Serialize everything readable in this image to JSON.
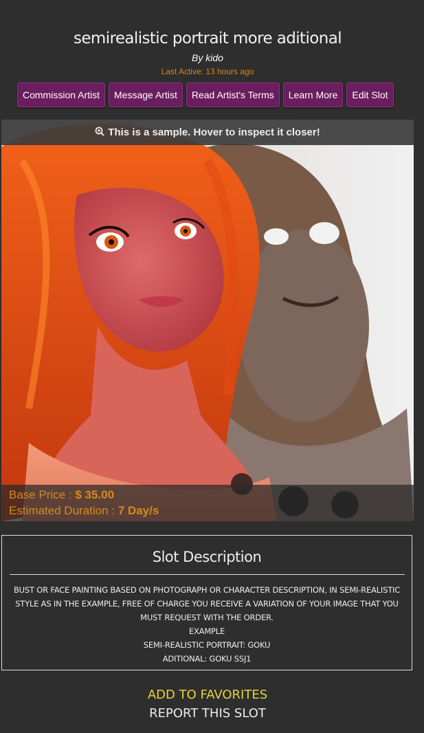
{
  "header": {
    "title": "semirealistic portrait more aditional",
    "by": "By kido",
    "last_active": "Last Active: 13 hours ago"
  },
  "buttons": [
    {
      "label": "Commission Artist"
    },
    {
      "label": "Message Artist"
    },
    {
      "label": "Read Artist's Terms"
    },
    {
      "label": "Learn More"
    },
    {
      "label": "Edit Slot"
    }
  ],
  "sample": {
    "notice": "This is a sample. Hover to inspect it closer!",
    "icon": "zoom-in-icon",
    "base_price_label": "Base Price : ",
    "base_price_value": "$ 35.00",
    "duration_label": "Estimated Duration : ",
    "duration_value": "7 Day/s"
  },
  "description": {
    "title": "Slot Description",
    "lines": [
      "BUST OR FACE PAINTING BASED ON PHOTOGRAPH OR CHARACTER DESCRIPTION, IN SEMI-REALISTIC STYLE AS IN THE EXAMPLE, FREE OF CHARGE YOU RECEIVE A VARIATION OF YOUR IMAGE THAT YOU MUST REQUEST WITH THE ORDER.",
      "EXAMPLE",
      "SEMI-REALISTIC PORTRAIT: GOKU",
      "ADITIONAL: GOKU SSJ1"
    ]
  },
  "actions": {
    "favorites": "ADD TO FAVORITES",
    "report": "REPORT THIS SLOT"
  },
  "colors": {
    "background": "#2e2e2e",
    "button": "#6a1d5f",
    "accent_orange": "#d58a1a",
    "favorites_yellow": "#e6d33a"
  }
}
